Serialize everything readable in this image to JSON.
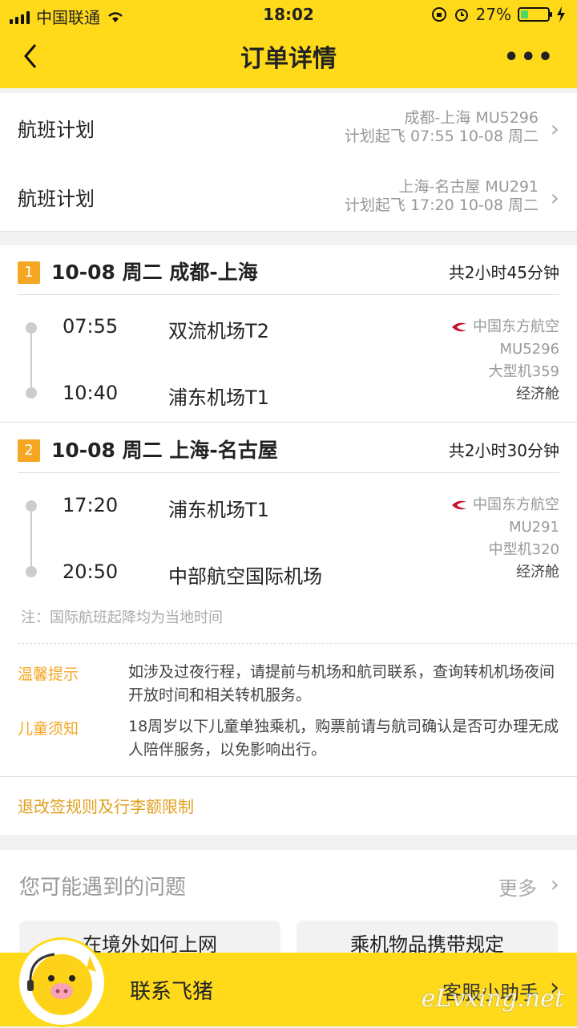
{
  "status_bar": {
    "carrier": "中国联通",
    "time": "18:02",
    "battery": "27%",
    "battery_level": 0.27
  },
  "nav": {
    "back_icon": "chevron-left",
    "title": "订单详情",
    "more_icon": "•••"
  },
  "flight_plans": [
    {
      "label": "航班计划",
      "route": "成都-上海 MU5296",
      "depart": "计划起飞 07:55 10-08 周二"
    },
    {
      "label": "航班计划",
      "route": "上海-名古屋 MU291",
      "depart": "计划起飞 17:20 10-08 周二"
    }
  ],
  "segments": [
    {
      "num": "1",
      "title": "10-08 周二 成都-上海",
      "duration": "共2小时45分钟",
      "dep_time": "07:55",
      "dep_airport": "双流机场T2",
      "arr_time": "10:40",
      "arr_airport": "浦东机场T1",
      "airline": "中国东方航空",
      "flight_no": "MU5296",
      "aircraft": "大型机359",
      "cabin": "经济舱"
    },
    {
      "num": "2",
      "title": "10-08 周二 上海-名古屋",
      "duration": "共2小时30分钟",
      "dep_time": "17:20",
      "dep_airport": "浦东机场T1",
      "arr_time": "20:50",
      "arr_airport": "中部航空国际机场",
      "airline": "中国东方航空",
      "flight_no": "MU291",
      "aircraft": "中型机320",
      "cabin": "经济舱"
    }
  ],
  "note": "注：国际航班起降均为当地时间",
  "tips": [
    {
      "label": "温馨提示",
      "text": "如涉及过夜行程，请提前与机场和航司联系，查询转机机场夜间开放时间和相关转机服务。"
    },
    {
      "label": "儿童须知",
      "text": "18周岁以下儿童单独乘机，购票前请与航司确认是否可办理无成人陪伴服务，以免影响出行。"
    }
  ],
  "rules_link": "退改签规则及行李额限制",
  "faq": {
    "title": "您可能遇到的问题",
    "more": "更多",
    "items": [
      "在境外如何上网",
      "乘机物品携带规定"
    ]
  },
  "bottom": {
    "contact": "联系飞猪",
    "assistant": "客服小助手"
  },
  "watermark": "eLvxing.net",
  "colors": {
    "brand_yellow": "#ffda1a",
    "accent_orange": "#f5a623"
  }
}
